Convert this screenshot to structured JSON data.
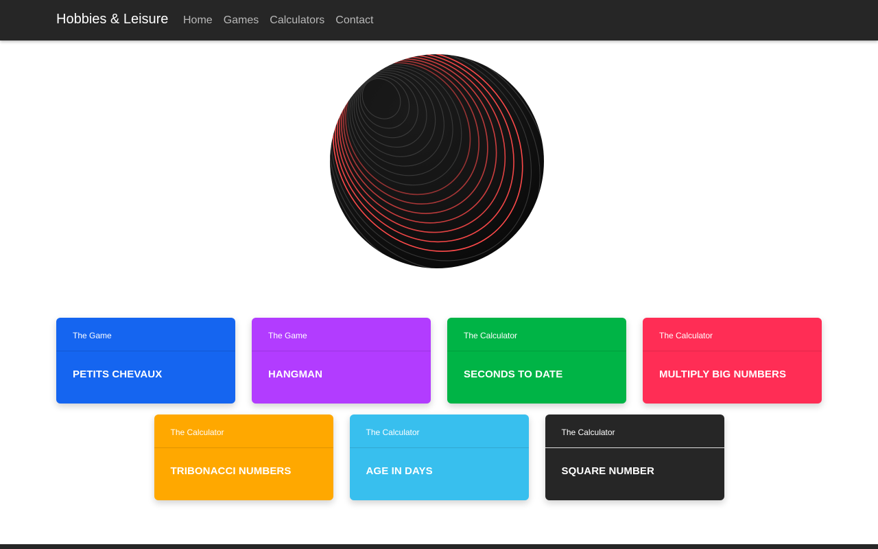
{
  "navbar": {
    "brand": "Hobbies & Leisure",
    "links": [
      {
        "label": "Home"
      },
      {
        "label": "Games"
      },
      {
        "label": "Calculators"
      },
      {
        "label": "Contact"
      }
    ]
  },
  "hero": {
    "image": "striped-black-sphere",
    "stripe_accent_color": "#ff4a4a"
  },
  "cards": [
    {
      "subtitle": "The Game",
      "title": "PETITS CHEVAUX",
      "color": "#1565f0"
    },
    {
      "subtitle": "The Game",
      "title": "HANGMAN",
      "color": "#b23cff"
    },
    {
      "subtitle": "The Calculator",
      "title": "SECONDS TO DATE",
      "color": "#00b446"
    },
    {
      "subtitle": "The Calculator",
      "title": "MULTIPLY BIG NUMBERS",
      "color": "#ff2d55"
    },
    {
      "subtitle": "The Calculator",
      "title": "TRIBONACCI NUMBERS",
      "color": "#ffa800"
    },
    {
      "subtitle": "The Calculator",
      "title": "AGE IN DAYS",
      "color": "#38bfee"
    },
    {
      "subtitle": "The Calculator",
      "title": "SQUARE NUMBER",
      "color": "#262626"
    }
  ]
}
